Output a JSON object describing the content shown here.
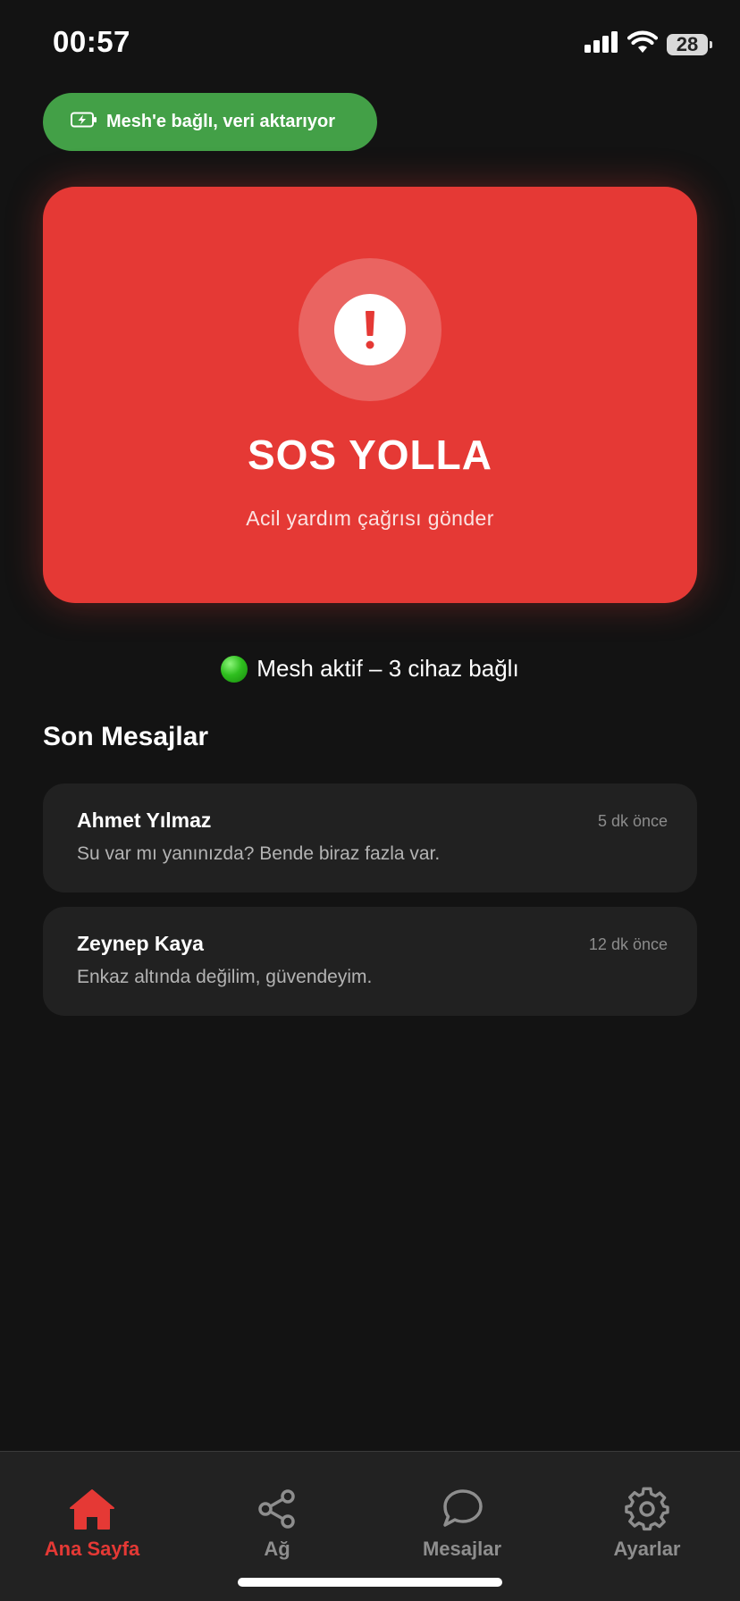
{
  "status_bar": {
    "time": "00:57",
    "battery": "28",
    "icons": [
      "signal-icon",
      "wifi-icon",
      "battery-icon"
    ]
  },
  "mesh_pill": {
    "text": "Mesh'e bağlı, veri aktarıyor",
    "icon": "battery-charging-icon",
    "color": "#43a047"
  },
  "sos": {
    "title": "SOS YOLLA",
    "subtitle": "Acil yardım çağrısı gönder",
    "icon": "alert-icon",
    "color": "#e53935"
  },
  "mesh_status": {
    "text": "Mesh aktif – 3 cihaz bağlı",
    "icon": "green-circle"
  },
  "messages": {
    "title": "Son Mesajlar",
    "items": [
      {
        "sender": "Ahmet Yılmaz",
        "time": "5 dk önce",
        "text": "Su var mı yanınızda? Bende biraz fazla var."
      },
      {
        "sender": "Zeynep Kaya",
        "time": "12 dk önce",
        "text": "Enkaz altında değilim, güvendeyim."
      }
    ]
  },
  "tabs": [
    {
      "label": "Ana Sayfa",
      "icon": "home-icon",
      "active": true
    },
    {
      "label": "Ağ",
      "icon": "share-icon",
      "active": false
    },
    {
      "label": "Mesajlar",
      "icon": "chat-icon",
      "active": false
    },
    {
      "label": "Ayarlar",
      "icon": "gear-icon",
      "active": false
    }
  ],
  "colors": {
    "background": "#131313",
    "accent": "#e53935",
    "success": "#43a047",
    "inactive": "#8e8e8e"
  }
}
